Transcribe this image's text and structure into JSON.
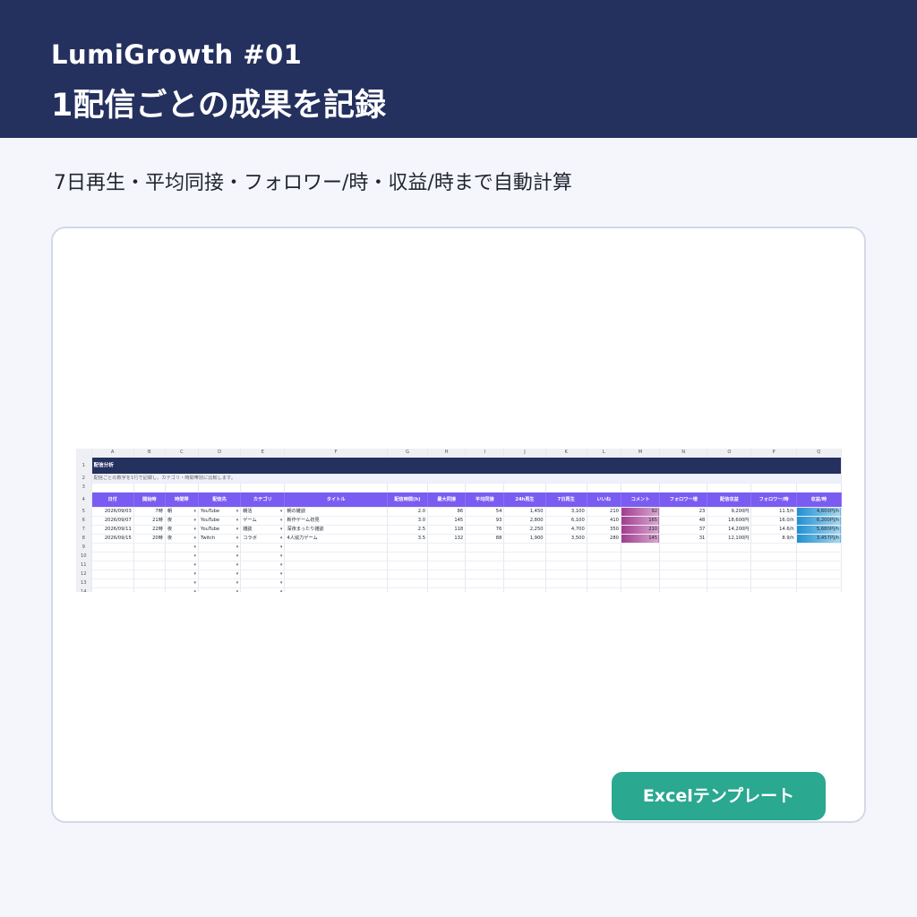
{
  "header": {
    "subtitle": "LumiGrowth #01",
    "title": "1配信ごとの成果を記録"
  },
  "description": "7日再生・平均同接・フォロワー/時・収益/時まで自動計算",
  "sheet": {
    "columns": [
      "A",
      "B",
      "C",
      "D",
      "E",
      "F",
      "G",
      "H",
      "I",
      "J",
      "K",
      "L",
      "M",
      "N",
      "O",
      "P",
      "Q"
    ],
    "title": "配信分析",
    "note": "配信ごとの数字を1行で記録し、カテゴリ・時間帯別に比較します。",
    "headers": [
      "日付",
      "開始時",
      "時間帯",
      "配信先",
      "カテゴリ",
      "タイトル",
      "配信時間(h)",
      "最大同接",
      "平均同接",
      "24h再生",
      "7日再生",
      "いいね",
      "コメント",
      "フォロワー増",
      "配信収益",
      "フォロワー/時",
      "収益/時"
    ],
    "rows": [
      [
        "2026/09/03",
        "7時",
        "朝",
        "YouTube",
        "朝活",
        "朝の雑談",
        "2.0",
        "86",
        "54",
        "1,450",
        "3,100",
        "210",
        "92",
        "23",
        "9,200円",
        "11.5/h",
        "4,600円/h"
      ],
      [
        "2026/09/07",
        "21時",
        "夜",
        "YouTube",
        "ゲーム",
        "新作ゲーム初見",
        "3.0",
        "145",
        "93",
        "2,800",
        "6,100",
        "410",
        "165",
        "48",
        "18,600円",
        "16.0/h",
        "6,200円/h"
      ],
      [
        "2026/09/11",
        "22時",
        "夜",
        "YouTube",
        "雑談",
        "深夜まったり雑談",
        "2.5",
        "118",
        "76",
        "2,250",
        "4,700",
        "350",
        "210",
        "37",
        "14,200円",
        "14.6/h",
        "5,680円/h"
      ],
      [
        "2026/09/15",
        "20時",
        "夜",
        "Twitch",
        "コラボ",
        "4人協力ゲーム",
        "3.5",
        "132",
        "88",
        "1,900",
        "3,500",
        "280",
        "145",
        "31",
        "12,100円",
        "8.9/h",
        "3,457円/h"
      ]
    ],
    "row_numbers": [
      "1",
      "2",
      "3",
      "4",
      "5",
      "6",
      "7",
      "8",
      "9",
      "10",
      "11",
      "12",
      "13",
      "14"
    ]
  },
  "button": {
    "label": "Excelテンプレート"
  },
  "colors": {
    "header_bg": "#24305e",
    "table_header": "#7b5cf2",
    "button": "#2aa890",
    "bar_follow": "#a13a8f",
    "bar_revenue": "#1f8fd1"
  }
}
